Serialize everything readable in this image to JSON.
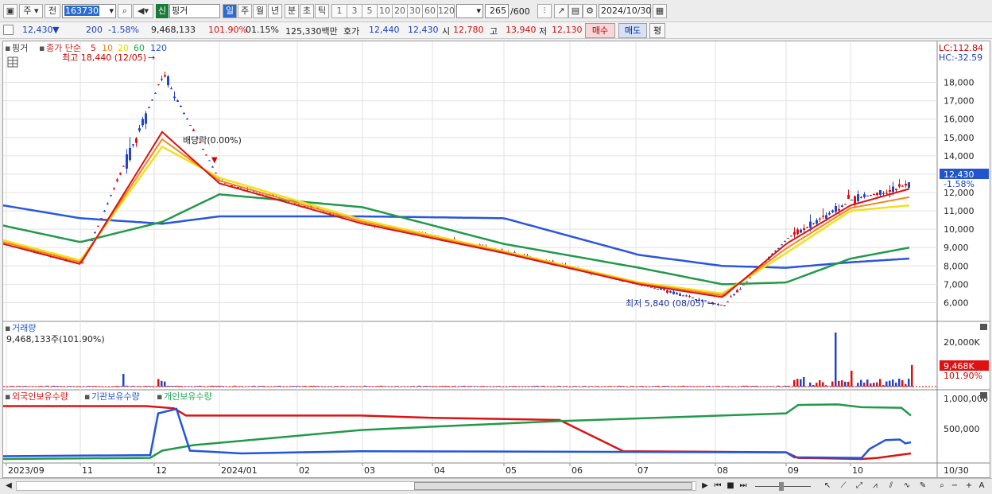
{
  "toolbar": {
    "market_label": "주",
    "prev_label": "전",
    "code_value": "163730",
    "new_badge": "신",
    "name_value": "핑거",
    "period_buttons": [
      "일",
      "주",
      "월",
      "년",
      "분",
      "초",
      "틱"
    ],
    "interval_buttons": [
      "1",
      "3",
      "5",
      "10",
      "20",
      "30",
      "60",
      "120"
    ],
    "bar_count": "265",
    "bar_max": "/600",
    "date_value": "2024/10/30"
  },
  "quote": {
    "price": "12,430",
    "arrow": "▼",
    "change": "200",
    "change_pct": "-1.58%",
    "volume": "9,468,133",
    "volume_pct": "101.90%",
    "turnover_pct": "01.15%",
    "amount": "125,330백만",
    "bid_label": "호가",
    "ask": "12,440",
    "bid": "12,430",
    "open_label": "시",
    "open": "12,780",
    "high_label": "고",
    "high": "13,940",
    "low_label": "저",
    "low": "12,130",
    "buy_label": "매수",
    "sell_label": "매도",
    "eval_label": "평"
  },
  "price_panel": {
    "stock_tag": "핑거",
    "ma_title": "종가 단순",
    "ma_periods": [
      "5",
      "10",
      "20",
      "60",
      "120"
    ],
    "ma_colors": [
      "#dd1111",
      "#ee8822",
      "#eeee22",
      "#22aa44",
      "#2255dd"
    ],
    "max_label": "최고 18,440 (12/05)",
    "min_label": "최저 5,840 (08/05)",
    "dividend_label": "배당락(0.00%)",
    "lc_label": "LC:112.84",
    "hc_label": "HC:-32.59",
    "current_price_tag": "12,430",
    "current_pct_tag": "-1.58%",
    "y_ticks": [
      "18,000",
      "17,000",
      "16,000",
      "15,000",
      "14,000",
      "13,000",
      "12,000",
      "11,000",
      "10,000",
      "9,000",
      "8,000",
      "7,000",
      "6,000"
    ]
  },
  "volume_panel": {
    "title": "거래량",
    "value_label": "9,468,133주(101.90%)",
    "y_tick": "20,000K",
    "current_tag": "9,468K",
    "current_pct": "101.90%"
  },
  "holdings_panel": {
    "series_labels": [
      "외국인보유수량",
      "기관보유수량",
      "개인보유수량"
    ],
    "series_colors": [
      "#dd1111",
      "#2255dd",
      "#22aa55"
    ],
    "y_ticks": [
      "1,000,000",
      "500,000"
    ]
  },
  "x_axis": [
    "2023/09",
    "11",
    "12",
    "2024/01",
    "02",
    "03",
    "04",
    "05",
    "06",
    "07",
    "08",
    "09",
    "10"
  ],
  "x_axis_end": "10/30",
  "chart_data": {
    "type": "line",
    "title": "",
    "series": [
      {
        "name": "종가",
        "x": [
          "2023/09",
          "2023/11",
          "2023/12-05",
          "2024/01",
          "2024/03",
          "2024/05",
          "2024/07",
          "2024/08-05",
          "2024/09",
          "2024/10",
          "2024/10-30"
        ],
        "values": [
          9300,
          8100,
          18440,
          12600,
          10400,
          8800,
          7000,
          5840,
          9500,
          11600,
          12430
        ]
      },
      {
        "name": "5",
        "values": [
          9200,
          8100,
          15300,
          12500,
          10300,
          8700,
          7000,
          6300,
          9200,
          11300,
          12200
        ]
      },
      {
        "name": "20",
        "values": [
          9400,
          8300,
          14500,
          12800,
          10500,
          8800,
          7100,
          6500,
          8700,
          11000,
          11300
        ]
      },
      {
        "name": "60",
        "values": [
          10200,
          9300,
          10400,
          11900,
          11200,
          9200,
          7900,
          7000,
          7100,
          8400,
          9000
        ]
      },
      {
        "name": "120",
        "values": [
          11300,
          10600,
          10300,
          10700,
          10700,
          10600,
          8600,
          8000,
          7900,
          8200,
          8400
        ]
      }
    ],
    "ylim": [
      5500,
      18500
    ]
  }
}
